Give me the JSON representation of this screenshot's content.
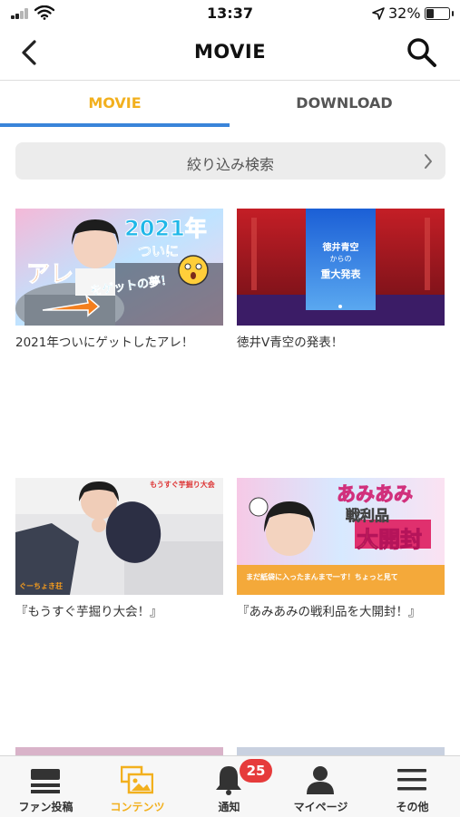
{
  "status_bar": {
    "time": "13:37",
    "battery_percent": "32%",
    "icons": [
      "signal-icon",
      "wifi-icon",
      "location-arrow-icon",
      "battery-icon"
    ]
  },
  "nav": {
    "title": "MOVIE",
    "back_icon": "chevron-left-icon",
    "search_icon": "search-icon"
  },
  "tabs": [
    {
      "label": "MOVIE",
      "active": true
    },
    {
      "label": "DOWNLOAD",
      "active": false
    }
  ],
  "filter": {
    "label": "絞り込み検索",
    "icon": "chevron-right-icon"
  },
  "videos": [
    {
      "title": "2021年ついにゲットしたアレ！",
      "thumb_text": [
        "2021年",
        "ついに",
        "アレ",
        "をゲットの夢！"
      ]
    },
    {
      "title": "徳井V青空の発表！",
      "thumb_text": [
        "徳井青空",
        "からの",
        "重大発表"
      ]
    },
    {
      "title": "『もうすぐ芋掘り大会！』",
      "thumb_text": [
        "もうすぐ芋掘り大会",
        "ぐーちょき荘"
      ]
    },
    {
      "title": "『あみあみの戦利品を大開封！』",
      "thumb_text": [
        "あみあみ",
        "戦利品",
        "大開封",
        "まだ紙袋に入ったまんまで一す！ちょっと見て"
      ]
    }
  ],
  "bottom_nav": [
    {
      "label": "ファン投稿",
      "icon": "fan-post-icon",
      "active": false
    },
    {
      "label": "コンテンツ",
      "icon": "contents-icon",
      "active": true
    },
    {
      "label": "通知",
      "icon": "bell-icon",
      "active": false,
      "badge": "25"
    },
    {
      "label": "マイページ",
      "icon": "person-icon",
      "active": false
    },
    {
      "label": "その他",
      "icon": "menu-icon",
      "active": false
    }
  ],
  "colors": {
    "accent": "#f2b01e",
    "tab_underline": "#3a84d9",
    "badge": "#e63b3b",
    "filter_bg": "#ececec"
  }
}
